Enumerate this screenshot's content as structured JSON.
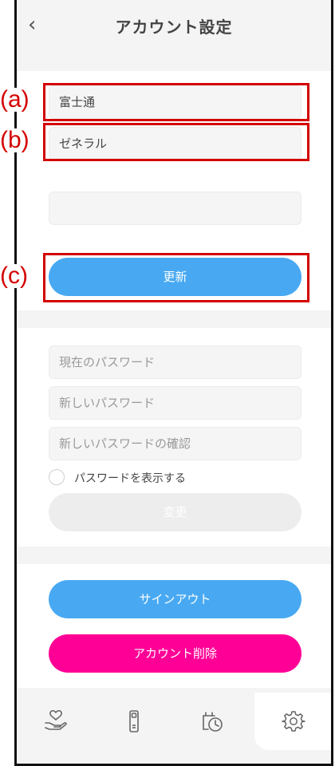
{
  "header": {
    "title": "アカウント設定",
    "back_icon": "chevron-left-icon"
  },
  "profile": {
    "last_name_value": "富士通",
    "first_name_value": "ゼネラル",
    "third_field_value": "",
    "update_button_label": "更新"
  },
  "password": {
    "current_placeholder": "現在のパスワード",
    "new_placeholder": "新しいパスワード",
    "confirm_placeholder": "新しいパスワードの確認",
    "show_password_label": "パスワードを表示する",
    "change_button_label": "変更"
  },
  "account": {
    "signout_label": "サインアウト",
    "delete_label": "アカウント削除"
  },
  "callouts": {
    "a": "(a)",
    "b": "(b)",
    "c": "(c)"
  },
  "tabbar": {
    "tabs": [
      "hand-heart-icon",
      "remote-control-icon",
      "timer-clock-icon",
      "gear-icon"
    ],
    "active": "gear-icon"
  },
  "colors": {
    "primary_blue": "#48a9f2",
    "delete_pink": "#ff0096",
    "annotation_red": "#d40000"
  }
}
